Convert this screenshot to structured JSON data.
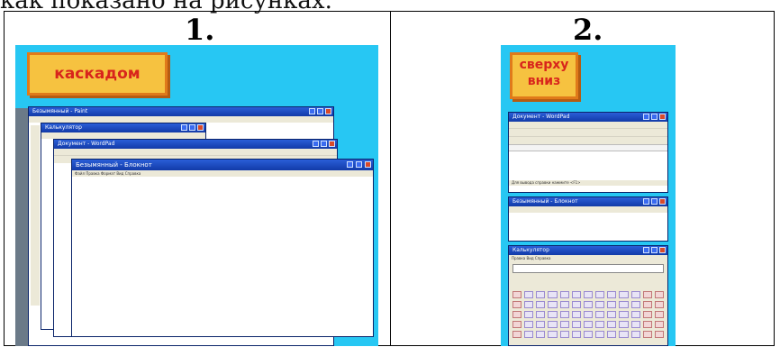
{
  "header_text": "как показано на рисунках.",
  "cells": [
    {
      "number": "1.",
      "label": "каскадом",
      "windows": {
        "paint_title": "Безымянный - Paint",
        "calc_title": "Калькулятор",
        "wordpad_title": "Документ - WordPad",
        "notepad_title": "Безымянный - Блокнот",
        "notepad_menu": "Файл  Правка  Формат  Вид  Справка"
      }
    },
    {
      "number": "2.",
      "label_line1": "сверху",
      "label_line2": "вниз",
      "windows": {
        "wordpad_title": "Документ - WordPad",
        "notepad_title": "Безымянный - Блокнот",
        "calc_title": "Калькулятор",
        "calc_menu": "Правка  Вид  Справка",
        "wordpad_status": "Для вывода справки нажмите <F1>"
      }
    }
  ],
  "colors": {
    "panel_bg": "#27c7f3",
    "label_bg": "#f6c240",
    "label_text": "#d8251c"
  }
}
